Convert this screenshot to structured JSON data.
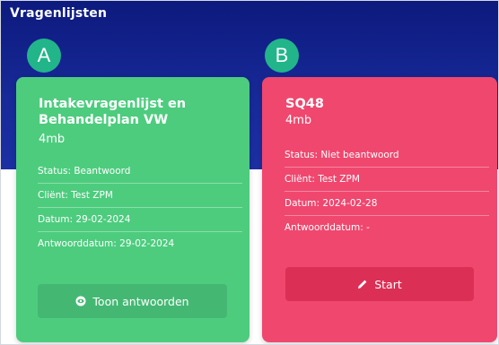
{
  "page": {
    "title": "Vragenlijsten"
  },
  "colors": {
    "header_bg": "#131f8c",
    "badge_bg": "#22b58a",
    "card_a_bg": "#4dcc7e",
    "card_b_bg": "#f0476e",
    "button_a_bg": "#44b873",
    "button_b_bg": "#dc2f55"
  },
  "cards": [
    {
      "badge": "A",
      "title": "Intakevragenlijst en Behandelplan VW",
      "size": "4mb",
      "info": [
        "Status: Beantwoord",
        "Cliënt: Test ZPM",
        "Datum: 29-02-2024",
        "Antwoorddatum: 29-02-2024"
      ],
      "button": {
        "label": "Toon antwoorden",
        "icon": "eye-icon"
      }
    },
    {
      "badge": "B",
      "title": "SQ48",
      "size": "4mb",
      "info": [
        "Status: Niet beantwoord",
        "Cliënt: Test ZPM",
        "Datum: 2024-02-28",
        "Antwoorddatum: -"
      ],
      "button": {
        "label": "Start",
        "icon": "pencil-icon"
      }
    }
  ]
}
